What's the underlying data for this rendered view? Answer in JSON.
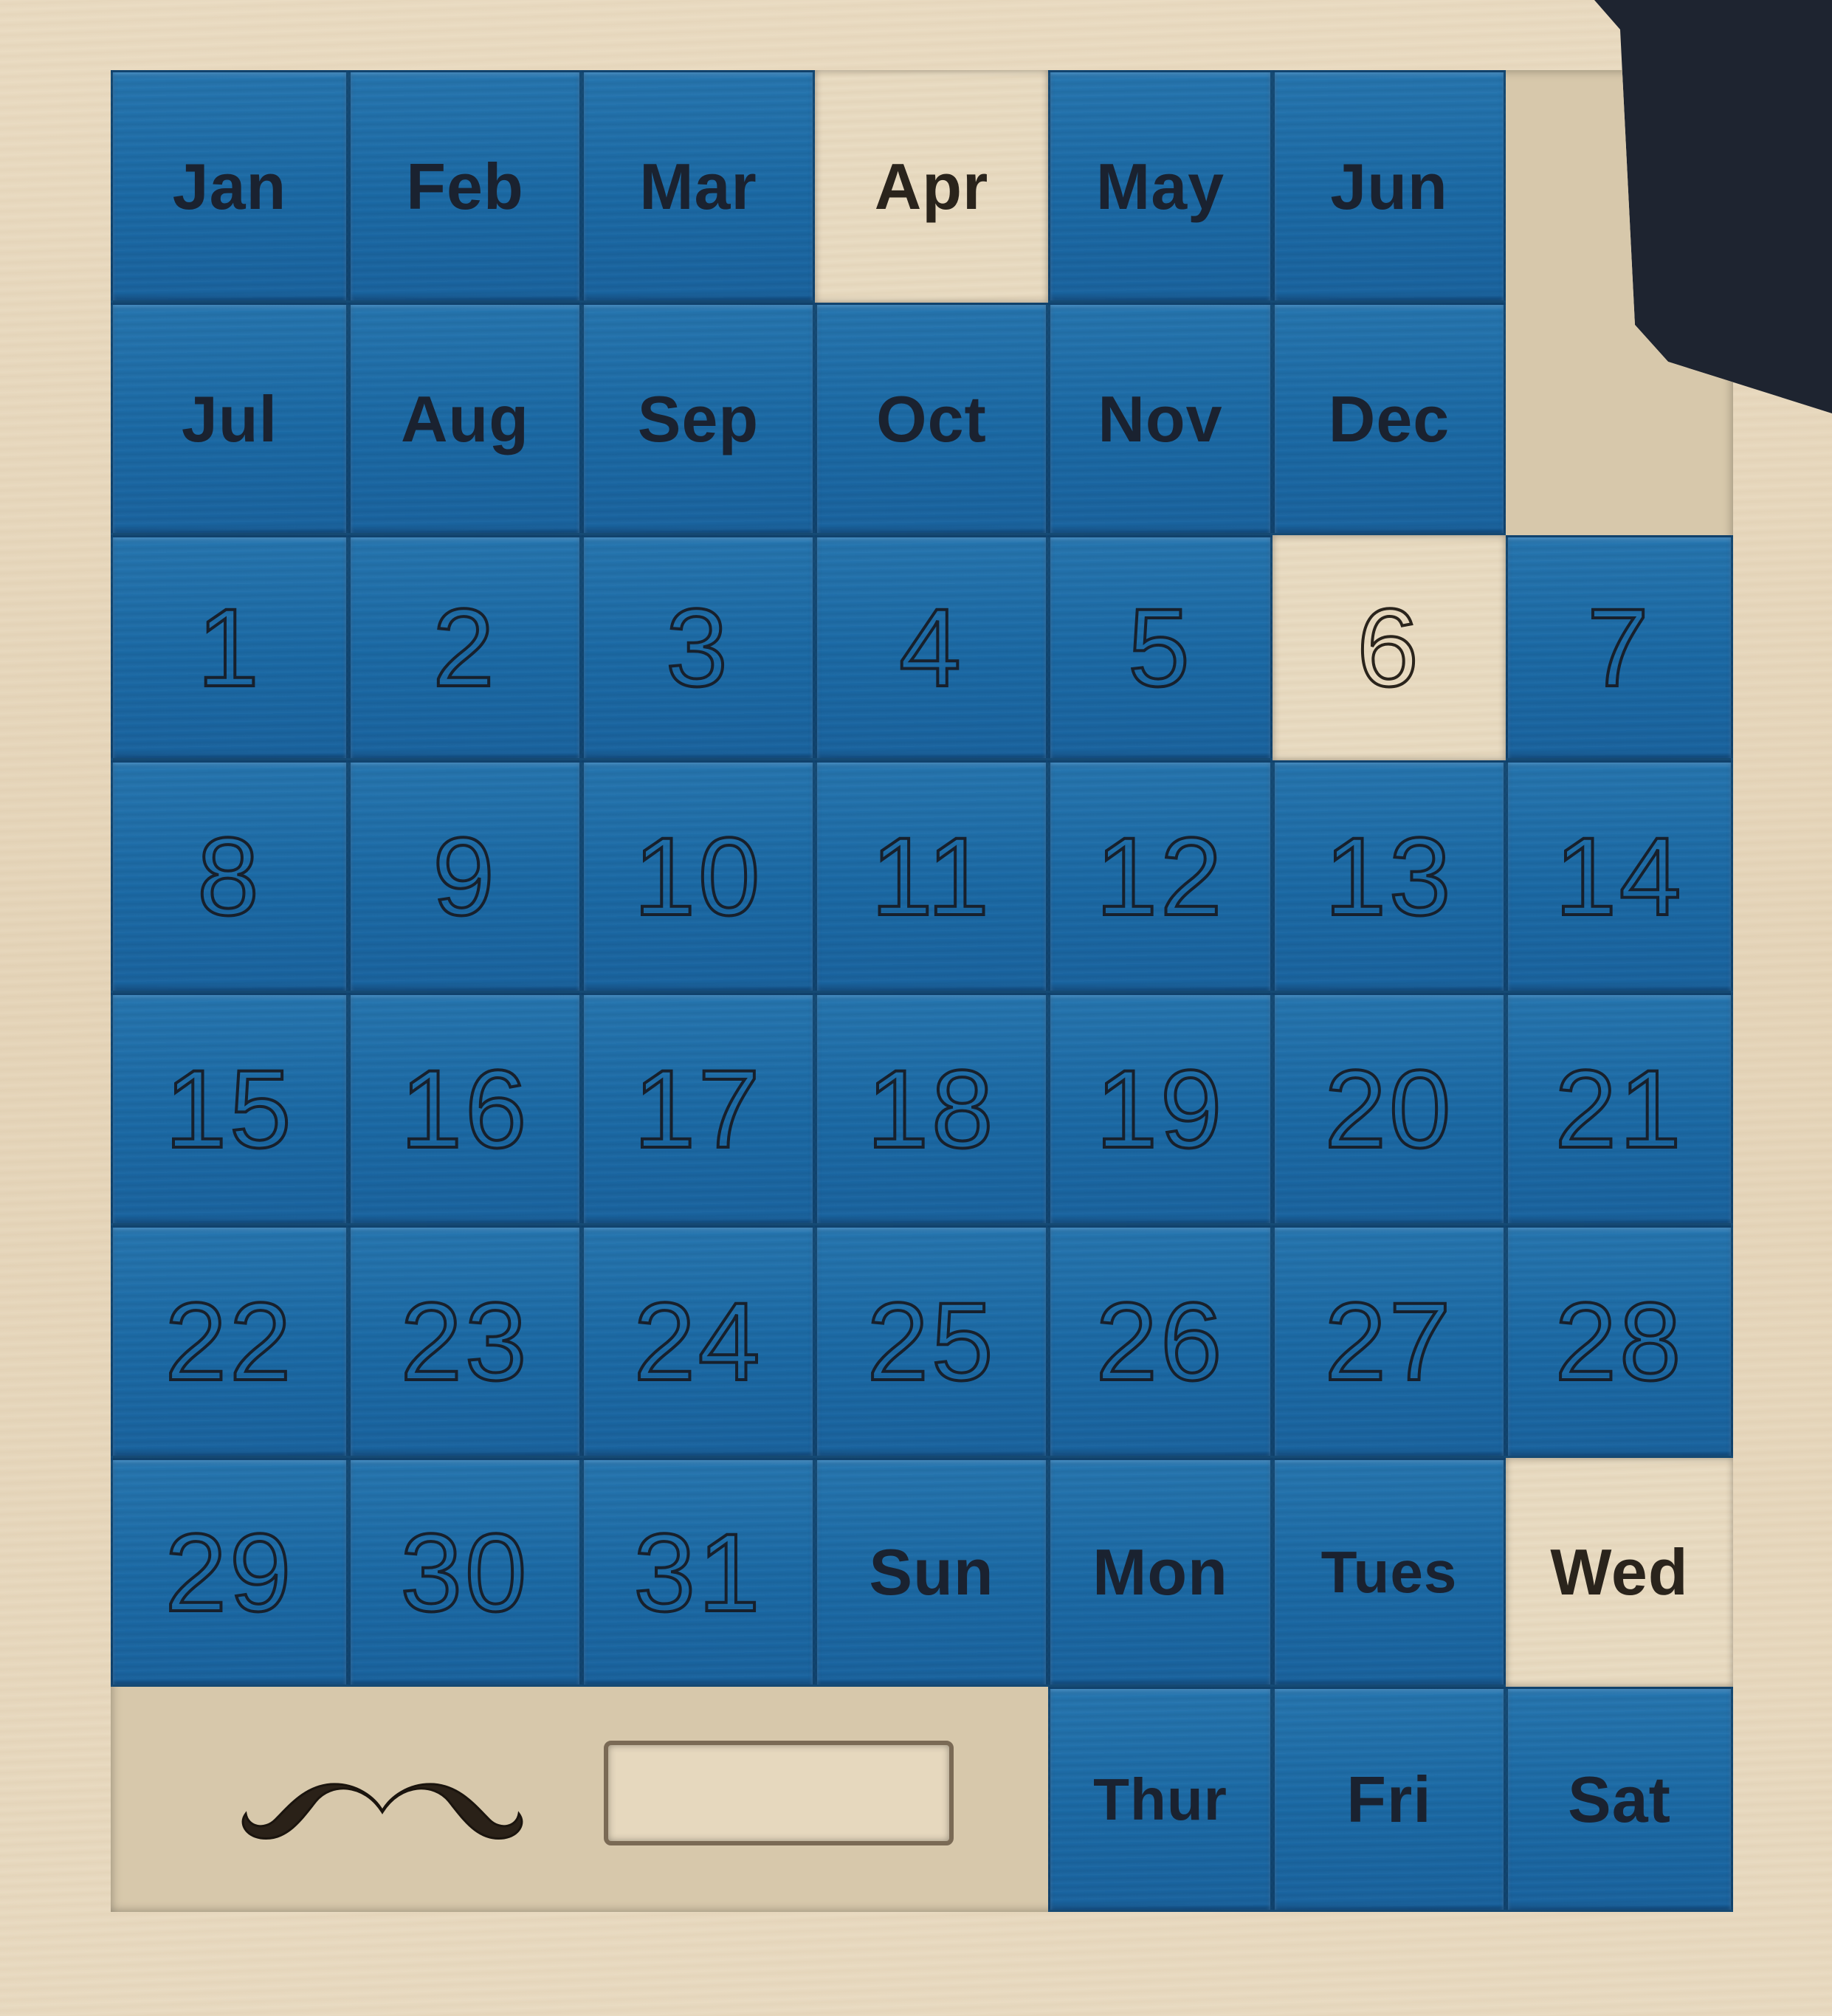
{
  "months": [
    "Jan",
    "Feb",
    "Mar",
    "Apr",
    "May",
    "Jun",
    "Jul",
    "Aug",
    "Sep",
    "Oct",
    "Nov",
    "Dec"
  ],
  "days": [
    "1",
    "2",
    "3",
    "4",
    "5",
    "6",
    "7",
    "8",
    "9",
    "10",
    "11",
    "12",
    "13",
    "14",
    "15",
    "16",
    "17",
    "18",
    "19",
    "20",
    "21",
    "22",
    "23",
    "24",
    "25",
    "26",
    "27",
    "28",
    "29",
    "30",
    "31"
  ],
  "weekdays": [
    "Sun",
    "Mon",
    "Tues",
    "Wed",
    "Thur",
    "Fri",
    "Sat"
  ],
  "revealed": [
    "Apr",
    "6",
    "Wed"
  ],
  "colors": {
    "tile": "#1b6aa6",
    "wood": "#e6d6bb",
    "engraving": "#17202c"
  },
  "icons": {
    "logo": "mustache-icon"
  }
}
